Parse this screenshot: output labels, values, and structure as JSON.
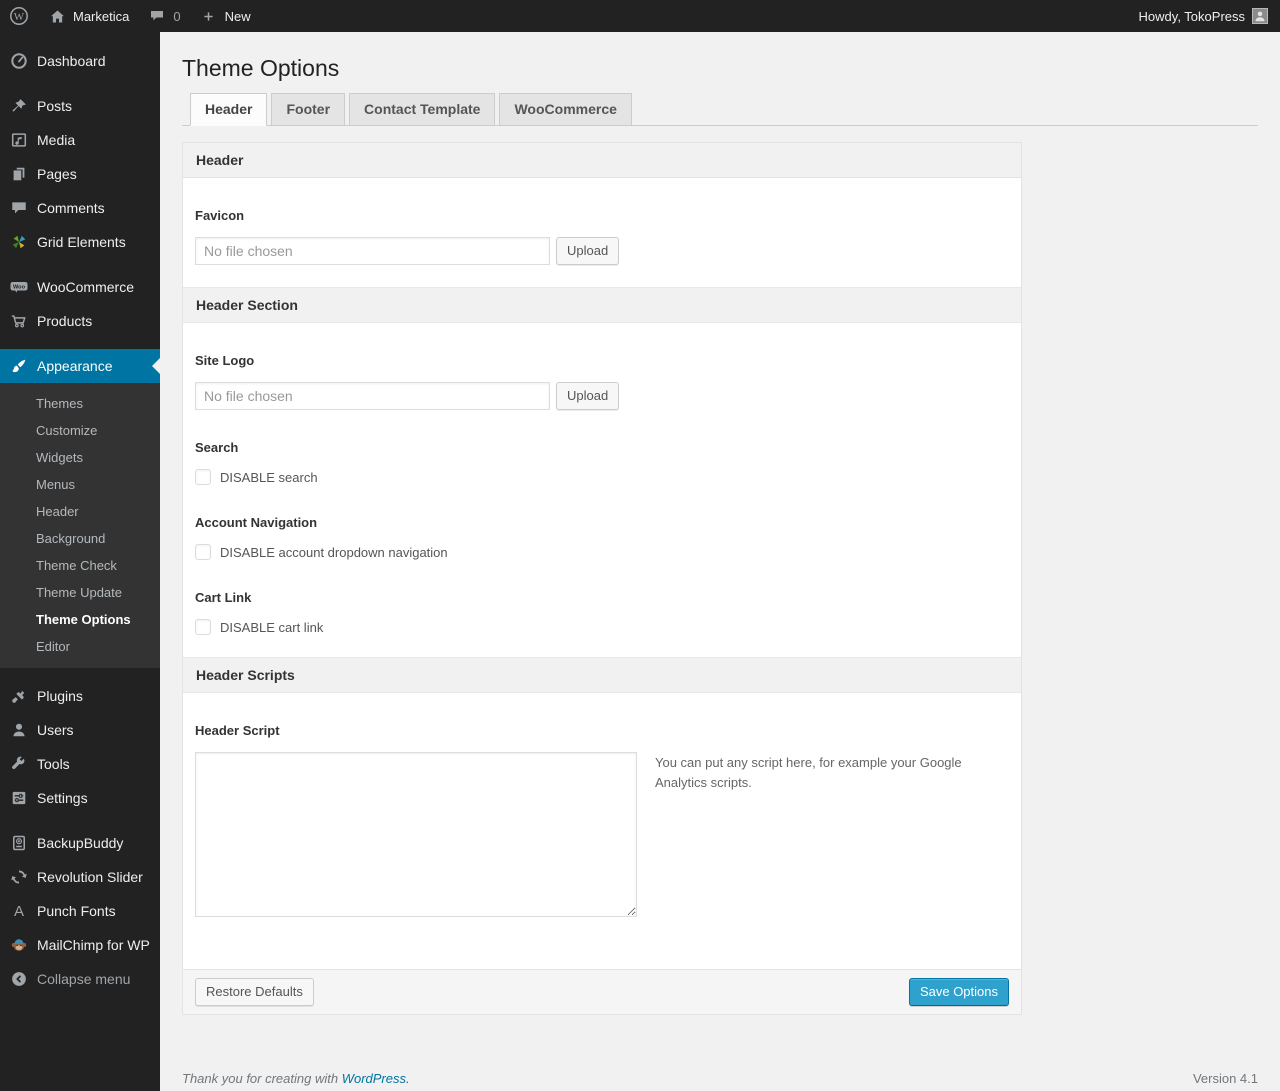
{
  "admin_bar": {
    "site_name": "Marketica",
    "comment_count": "0",
    "new_label": "New",
    "howdy": "Howdy, TokoPress"
  },
  "sidebar": {
    "group1": [
      "Dashboard"
    ],
    "group2": [
      "Posts",
      "Media",
      "Pages",
      "Comments",
      "Grid Elements"
    ],
    "group3": [
      "WooCommerce",
      "Products"
    ],
    "appearance_label": "Appearance",
    "appearance_submenu": [
      "Themes",
      "Customize",
      "Widgets",
      "Menus",
      "Header",
      "Background",
      "Theme Check",
      "Theme Update",
      "Theme Options",
      "Editor"
    ],
    "current_submenu_item": "Theme Options",
    "group4": [
      "Plugins",
      "Users",
      "Tools",
      "Settings"
    ],
    "group5": [
      "BackupBuddy",
      "Revolution Slider",
      "Punch Fonts",
      "MailChimp for WP"
    ],
    "collapse_label": "Collapse menu",
    "icons": {
      "dashboard": "gauge-icon",
      "posts": "pin-icon",
      "media": "media-frame-icon",
      "pages": "pages-icon",
      "comments": "comment-bubble-icon",
      "grid_elements": "pinwheel-icon",
      "woocommerce": "woo-badge-icon",
      "products": "cart-icon",
      "appearance": "paintbrush-icon",
      "plugins": "plug-icon",
      "users": "person-icon",
      "tools": "wrench-icon",
      "settings": "sliders-icon",
      "backupbuddy": "drive-icon",
      "revolution_slider": "refresh-icon",
      "punch_fonts": "letter-a-icon",
      "mailchimp": "monkey-icon",
      "collapse": "circle-arrow-left-icon"
    }
  },
  "page": {
    "title": "Theme Options",
    "tabs": [
      "Header",
      "Footer",
      "Contact Template",
      "WooCommerce"
    ],
    "active_tab": "Header"
  },
  "panel": {
    "box_title": "Header",
    "favicon": {
      "label": "Favicon",
      "value": "No file chosen",
      "button": "Upload"
    },
    "header_section_title": "Header Section",
    "site_logo": {
      "label": "Site Logo",
      "value": "No file chosen",
      "button": "Upload"
    },
    "search": {
      "label": "Search",
      "checkbox_label": "DISABLE search",
      "checked": false
    },
    "account_nav": {
      "label": "Account Navigation",
      "checkbox_label": "DISABLE account dropdown navigation",
      "checked": false
    },
    "cart_link": {
      "label": "Cart Link",
      "checkbox_label": "DISABLE cart link",
      "checked": false
    },
    "header_scripts_title": "Header Scripts",
    "header_script": {
      "label": "Header Script",
      "value": "",
      "help": "You can put any script here, for example your Google Analytics scripts."
    },
    "restore_button": "Restore Defaults",
    "save_button": "Save Options"
  },
  "page_footer": {
    "thanks_text": "Thank you for creating with",
    "thanks_link": "WordPress.",
    "version": "Version 4.1"
  },
  "colors": {
    "accent": "#0074a2",
    "primary_button": "#2ea2cc",
    "admin_dark": "#222222",
    "submenu_bg": "#333333",
    "page_bg": "#f1f1f1"
  }
}
